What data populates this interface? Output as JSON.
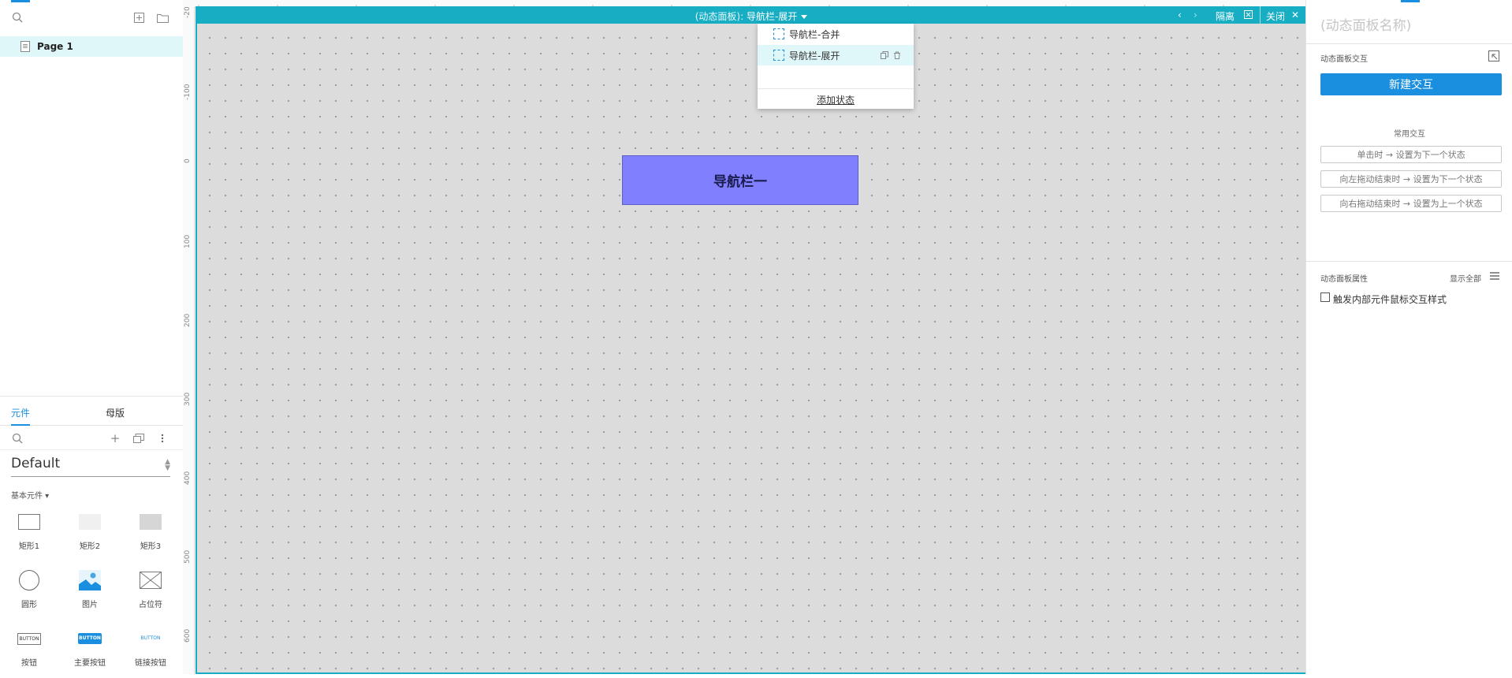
{
  "pages": {
    "items": [
      {
        "label": "Page 1"
      }
    ]
  },
  "library": {
    "tabs": [
      {
        "label": "元件"
      },
      {
        "label": "母版"
      }
    ],
    "selected_library": "Default",
    "section_label": "基本元件 ▾",
    "widgets": [
      {
        "label": "矩形1",
        "icon": "rectangle-1-icon"
      },
      {
        "label": "矩形2",
        "icon": "rectangle-2-icon"
      },
      {
        "label": "矩形3",
        "icon": "rectangle-3-icon"
      },
      {
        "label": "圆形",
        "icon": "circle-icon"
      },
      {
        "label": "图片",
        "icon": "image-icon"
      },
      {
        "label": "占位符",
        "icon": "placeholder-icon"
      },
      {
        "label": "按钮",
        "icon": "button-icon",
        "thumb_text": "BUTTON"
      },
      {
        "label": "主要按钮",
        "icon": "primary-button-icon",
        "thumb_text": "BUTTON"
      },
      {
        "label": "链接按钮",
        "icon": "link-button-icon",
        "thumb_text": "BUTTON"
      }
    ]
  },
  "ruler": {
    "vertical_labels": [
      "-20",
      "-100",
      "0",
      "100",
      "200",
      "300",
      "400",
      "500",
      "600"
    ]
  },
  "canvas_header": {
    "prefix": "(动态面板):",
    "state_name": "导航栏-展开",
    "isolate_label": "隔离",
    "close_label": "关闭"
  },
  "state_dropdown": {
    "states": [
      {
        "label": "导航栏-合并",
        "active": false
      },
      {
        "label": "导航栏-展开",
        "active": true
      }
    ],
    "add_state_label": "添加状态"
  },
  "canvas": {
    "nav_box_text": "导航栏一",
    "nav_box_color": "#8080ff"
  },
  "inspector": {
    "panel_name_placeholder": "(动态面板名称)",
    "interactions_title": "动态面板交互",
    "new_interaction_label": "新建交互",
    "common_title": "常用交互",
    "common_interactions": [
      "单击时 → 设置为下一个状态",
      "向左拖动结束时 → 设置为下一个状态",
      "向右拖动结束时 → 设置为上一个状态"
    ],
    "properties_title": "动态面板属性",
    "show_all_label": "显示全部",
    "trigger_label": "触发内部元件鼠标交互样式"
  },
  "colors": {
    "accent": "#1a8fdf",
    "canvas_frame": "#17aec4",
    "canvas_bg": "#dcdcdc"
  }
}
